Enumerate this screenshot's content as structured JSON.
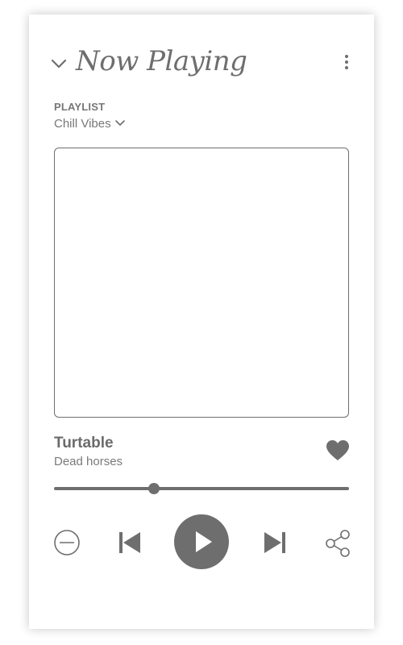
{
  "header": {
    "title": "Now Playing"
  },
  "playlist": {
    "label": "PLAYLIST",
    "name": "Chill Vibes"
  },
  "track": {
    "title": "Turtable",
    "artist": "Dead horses",
    "progress": 0.34
  },
  "controls": {
    "icons": [
      "chevron-down-icon",
      "more-vertical-icon",
      "heart-icon",
      "remove-icon",
      "skip-previous-icon",
      "play-icon",
      "skip-next-icon",
      "share-icon"
    ]
  },
  "colors": {
    "accent": "#6e6e6e",
    "background": "#ffffff"
  }
}
